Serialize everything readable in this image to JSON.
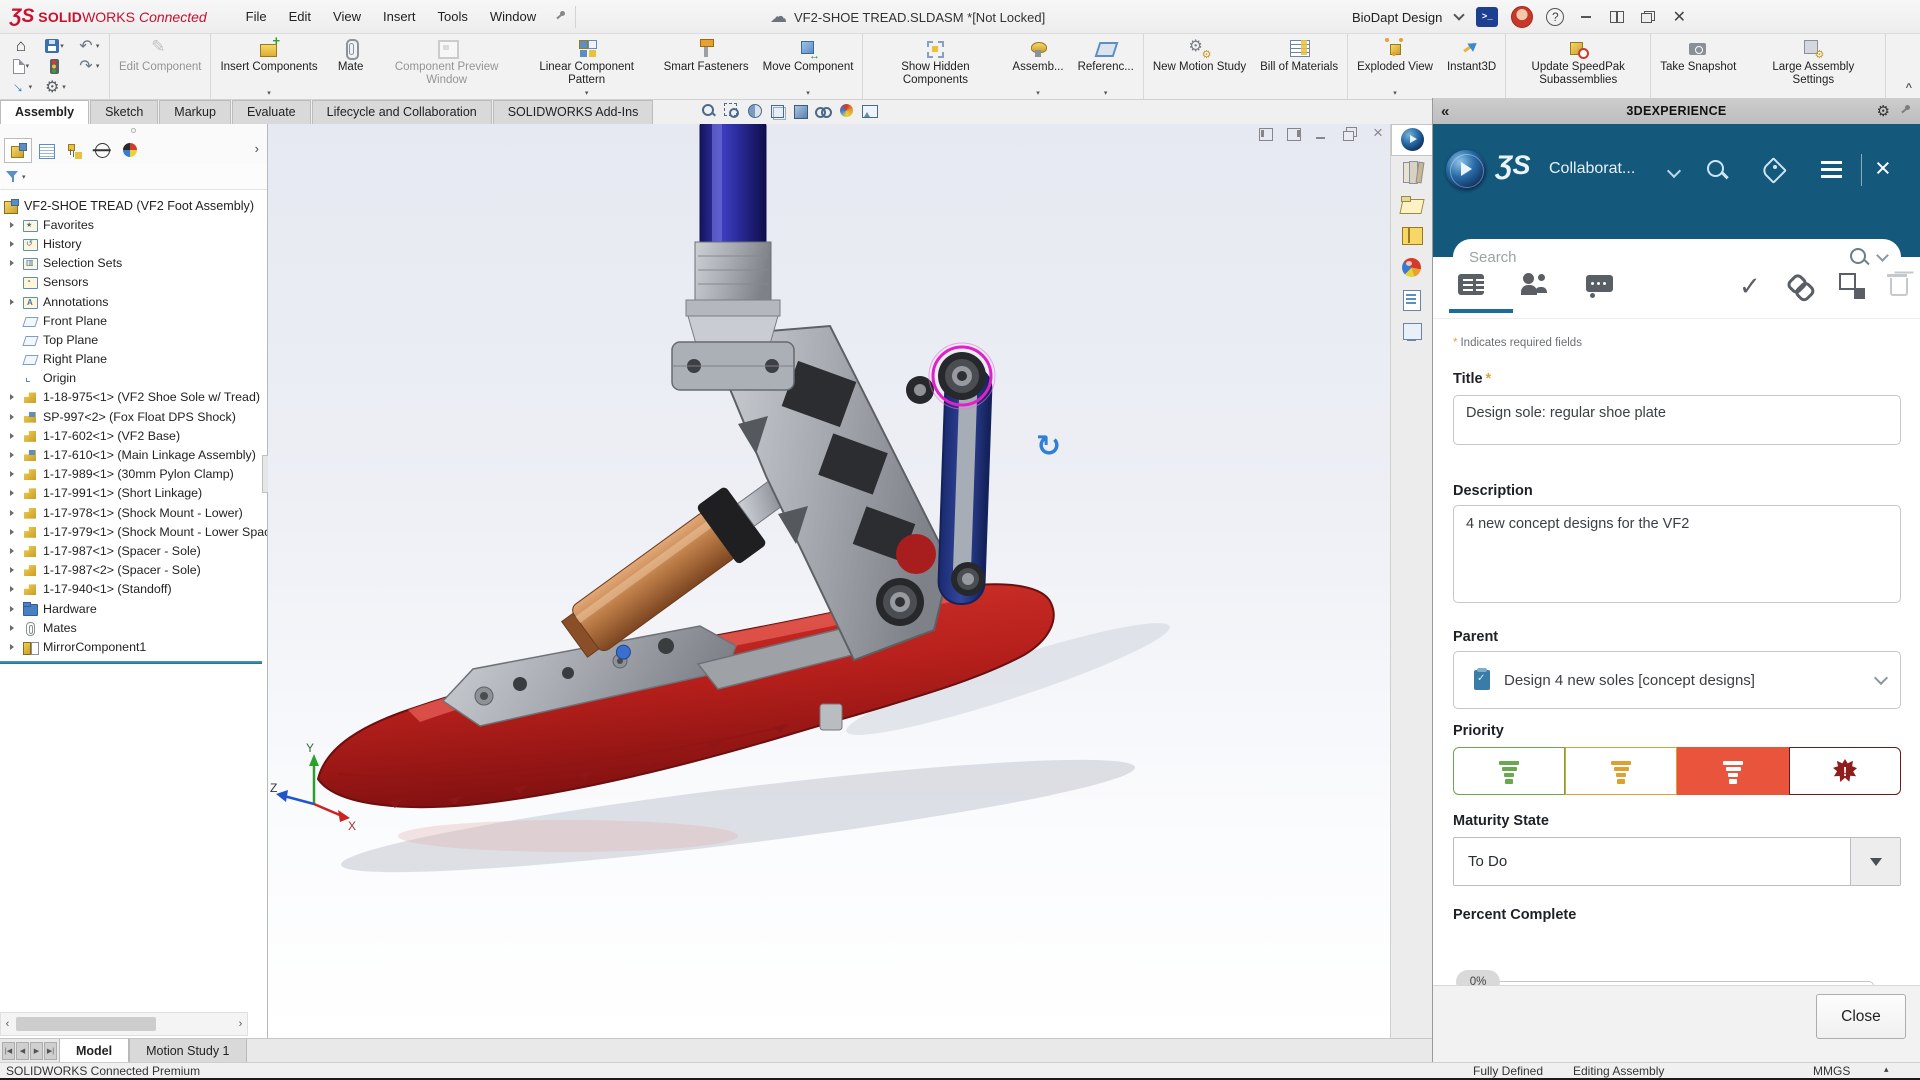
{
  "window": {
    "brand": {
      "mark": "ƷS",
      "bold": "SOLID",
      "rest": "WORKS",
      "suffix": "Connected",
      "color": "#c8102e"
    },
    "menus": [
      "File",
      "Edit",
      "View",
      "Insert",
      "Tools",
      "Window"
    ],
    "document_title": "VF2-SHOE TREAD.SLDASM *[Not Locked]",
    "workspace": "BioDapt Design"
  },
  "quick_access": [
    {
      "icon": "home",
      "caret": false
    },
    {
      "icon": "save",
      "caret": true
    },
    {
      "icon": "undo",
      "caret": true
    },
    {
      "icon": "new",
      "caret": true
    },
    {
      "icon": "rebuild",
      "caret": false
    },
    {
      "icon": "redo",
      "caret": true
    },
    {
      "icon": "publish",
      "caret": true
    },
    {
      "icon": "gear",
      "caret": true
    }
  ],
  "ribbon": {
    "collapse": "^",
    "groups": [
      {
        "buttons": [
          {
            "label": "Edit Component",
            "icon": "edit",
            "disabled": true,
            "dropdown": false
          }
        ]
      },
      {
        "buttons": [
          {
            "label": "Insert Components",
            "icon": "insert",
            "disabled": false,
            "dropdown": true
          },
          {
            "label": "Mate",
            "icon": "mate",
            "disabled": false,
            "dropdown": false
          },
          {
            "label": "Component Preview Window",
            "icon": "preview",
            "disabled": true,
            "dropdown": false
          },
          {
            "label": "Linear Component Pattern",
            "icon": "pattern",
            "disabled": false,
            "dropdown": true
          },
          {
            "label": "Smart Fasteners",
            "icon": "fastener",
            "disabled": false,
            "dropdown": false
          },
          {
            "label": "Move Component",
            "icon": "move",
            "disabled": false,
            "dropdown": true
          }
        ]
      },
      {
        "buttons": [
          {
            "label": "Show Hidden Components",
            "icon": "hidden",
            "disabled": false,
            "dropdown": false
          },
          {
            "label": "Assemb...",
            "icon": "asmfeat",
            "disabled": false,
            "dropdown": true
          },
          {
            "label": "Referenc...",
            "icon": "reference",
            "disabled": false,
            "dropdown": true
          }
        ]
      },
      {
        "buttons": [
          {
            "label": "New Motion Study",
            "icon": "motion",
            "disabled": false,
            "dropdown": false
          },
          {
            "label": "Bill of Materials",
            "icon": "bom",
            "disabled": false,
            "dropdown": false
          }
        ]
      },
      {
        "buttons": [
          {
            "label": "Exploded View",
            "icon": "exploded",
            "disabled": false,
            "dropdown": true
          },
          {
            "label": "Instant3D",
            "icon": "instant3d",
            "disabled": false,
            "dropdown": false
          }
        ]
      },
      {
        "buttons": [
          {
            "label": "Update SpeedPak Subassemblies",
            "icon": "speedpak",
            "disabled": false,
            "dropdown": false
          }
        ]
      },
      {
        "buttons": [
          {
            "label": "Take Snapshot",
            "icon": "snapshot",
            "disabled": false,
            "dropdown": false
          },
          {
            "label": "Large Assembly Settings",
            "icon": "las",
            "disabled": false,
            "dropdown": false
          }
        ]
      }
    ]
  },
  "view_tabs": {
    "active": "Assembly",
    "items": [
      "Assembly",
      "Sketch",
      "Markup",
      "Evaluate",
      "Lifecycle and Collaboration",
      "SOLIDWORKS Add-Ins"
    ]
  },
  "headsup": [
    "zoom-fit",
    "zoom-to-area",
    "section-view",
    "view-orientation",
    "display-style",
    "hide-show",
    "edit-appearance",
    "apply-scene"
  ],
  "doc_controls": [
    "tile-left",
    "tile-right",
    "minimize",
    "restore",
    "close"
  ],
  "feature_tree": {
    "tabs": [
      "features",
      "properties",
      "config",
      "dimxpert",
      "appearances"
    ],
    "items": [
      {
        "arrow": false,
        "icon": "assembly",
        "label": "VF2-SHOE TREAD (VF2 Foot Assembly)",
        "root": true
      },
      {
        "arrow": true,
        "icon": "folder-star",
        "label": "Favorites"
      },
      {
        "arrow": true,
        "icon": "folder-clock",
        "label": "History"
      },
      {
        "arrow": true,
        "icon": "folder-sets",
        "label": "Selection Sets"
      },
      {
        "arrow": false,
        "icon": "folder-sensor",
        "label": "Sensors"
      },
      {
        "arrow": true,
        "icon": "folder-a",
        "label": "Annotations"
      },
      {
        "arrow": false,
        "icon": "plane",
        "label": "Front Plane"
      },
      {
        "arrow": false,
        "icon": "plane",
        "label": "Top Plane"
      },
      {
        "arrow": false,
        "icon": "plane",
        "label": "Right Plane"
      },
      {
        "arrow": false,
        "icon": "origin",
        "label": "Origin"
      },
      {
        "arrow": true,
        "icon": "part",
        "label": "1-18-975<1> (VF2 Shoe Sole w/ Tread)"
      },
      {
        "arrow": true,
        "icon": "subassembly",
        "label": "SP-997<2> (Fox Float DPS Shock)"
      },
      {
        "arrow": true,
        "icon": "part",
        "label": "1-17-602<1> (VF2 Base)"
      },
      {
        "arrow": true,
        "icon": "subassembly",
        "label": "1-17-610<1> (Main Linkage Assembly)"
      },
      {
        "arrow": true,
        "icon": "part",
        "label": "1-17-989<1> (30mm Pylon Clamp)"
      },
      {
        "arrow": true,
        "icon": "part",
        "label": "1-17-991<1> (Short Linkage)"
      },
      {
        "arrow": true,
        "icon": "part",
        "label": "1-17-978<1> (Shock Mount - Lower)"
      },
      {
        "arrow": true,
        "icon": "part",
        "label": "1-17-979<1> (Shock Mount - Lower Spac"
      },
      {
        "arrow": true,
        "icon": "part",
        "label": "1-17-987<1> (Spacer - Sole)"
      },
      {
        "arrow": true,
        "icon": "part",
        "label": "1-17-987<2> (Spacer - Sole)"
      },
      {
        "arrow": true,
        "icon": "part",
        "label": "1-17-940<1> (Standoff)"
      },
      {
        "arrow": true,
        "icon": "folder-hardware",
        "label": "Hardware"
      },
      {
        "arrow": true,
        "icon": "mates",
        "label": "Mates"
      },
      {
        "arrow": true,
        "icon": "mirror",
        "label": "MirrorComponent1"
      }
    ]
  },
  "taskpane": [
    "3dexperience",
    "design-library",
    "file-explorer",
    "view-palette",
    "appearances-scenes",
    "custom-properties",
    "document-manager"
  ],
  "panel": {
    "header": {
      "collapse": "«",
      "title": "3DEXPERIENCE"
    },
    "appbar": {
      "logo": "ƷS",
      "app": "Collaborat..."
    },
    "search": {
      "placeholder": "Search"
    },
    "tabs": [
      "properties",
      "members",
      "comments"
    ],
    "actions": [
      {
        "name": "approve",
        "disabled": false
      },
      {
        "name": "link",
        "disabled": false
      },
      {
        "name": "subtask",
        "disabled": false
      },
      {
        "name": "delete",
        "disabled": true
      }
    ],
    "required_note": "Indicates required fields",
    "asterisk": "*",
    "fields": {
      "title": {
        "label": "Title",
        "required": true,
        "value": "Design sole: regular shoe plate"
      },
      "description": {
        "label": "Description",
        "value": "4 new concept designs for the VF2"
      },
      "parent": {
        "label": "Parent",
        "value": "Design 4 new soles [concept designs]"
      },
      "priority": {
        "label": "Priority",
        "options": [
          {
            "level": "low",
            "style": "green",
            "selected": false
          },
          {
            "level": "medium",
            "style": "orange",
            "selected": false
          },
          {
            "level": "high",
            "style": "red",
            "selected": true
          },
          {
            "level": "critical",
            "style": "critical",
            "selected": false
          }
        ]
      },
      "maturity": {
        "label": "Maturity State",
        "value": "To Do"
      },
      "percent": {
        "label": "Percent Complete",
        "value": "0%"
      }
    },
    "close_label": "Close",
    "colors": {
      "band_blue": "#14587c",
      "selected_red": "#e8543c",
      "accent_underline": "#1a6c9c"
    }
  },
  "model_tabs": {
    "active": "Model",
    "items": [
      "Model",
      "Motion Study 1"
    ]
  },
  "status_bar": {
    "left": "SOLIDWORKS Connected Premium",
    "defined": "Fully Defined",
    "mode": "Editing Assembly",
    "units": "MMGS"
  }
}
